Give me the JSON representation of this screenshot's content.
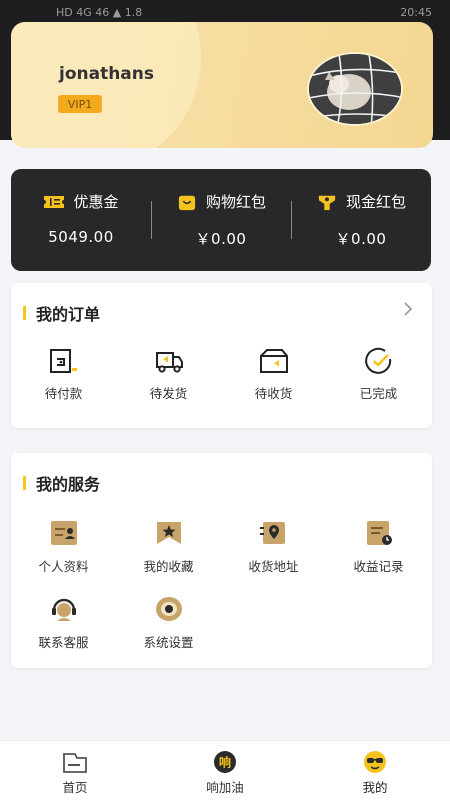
{
  "status_bar": {
    "left": "HD 4G 46 ▲ 1.8",
    "time": "20:45"
  },
  "profile": {
    "username": "jonathans",
    "vip": "VIP1"
  },
  "wallet": [
    {
      "label": "优惠金",
      "value": "5049.00",
      "icon": "coupon-icon"
    },
    {
      "label": "购物红包",
      "value": "￥0.00",
      "icon": "shopping-bag-icon"
    },
    {
      "label": "现金红包",
      "value": "￥0.00",
      "icon": "cash-gift-icon"
    }
  ],
  "orders": {
    "title": "我的订单",
    "items": [
      {
        "label": "待付款",
        "icon": "wallet-icon"
      },
      {
        "label": "待发货",
        "icon": "truck-icon"
      },
      {
        "label": "待收货",
        "icon": "box-icon"
      },
      {
        "label": "已完成",
        "icon": "clock-check-icon"
      }
    ]
  },
  "services": {
    "title": "我的服务",
    "items": [
      {
        "label": "个人资料",
        "icon": "profile-card-icon"
      },
      {
        "label": "我的收藏",
        "icon": "favorites-icon"
      },
      {
        "label": "收货地址",
        "icon": "location-icon"
      },
      {
        "label": "收益记录",
        "icon": "income-record-icon"
      },
      {
        "label": "联系客服",
        "icon": "headset-icon"
      },
      {
        "label": "系统设置",
        "icon": "settings-icon"
      }
    ]
  },
  "tabbar": [
    {
      "label": "首页",
      "icon": "home-icon"
    },
    {
      "label": "响加油",
      "icon": "fuel-brand-icon"
    },
    {
      "label": "我的",
      "icon": "mine-icon",
      "active": true
    }
  ],
  "colors": {
    "accent": "#f5c31c",
    "dark": "#28282a",
    "gold": "#c9a46a"
  }
}
